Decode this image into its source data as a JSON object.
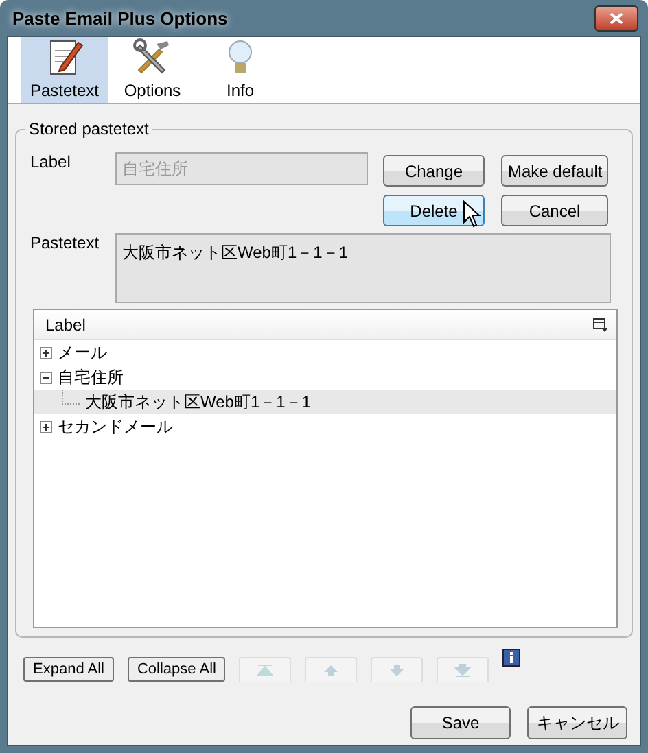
{
  "window": {
    "title": "Paste Email Plus Options"
  },
  "tabs": [
    {
      "label": "Pastetext",
      "selected": true
    },
    {
      "label": "Options",
      "selected": false
    },
    {
      "label": "Info",
      "selected": false
    }
  ],
  "group": {
    "title": "Stored pastetext",
    "label_field": {
      "label": "Label",
      "value": "自宅住所",
      "disabled": true
    },
    "buttons": [
      {
        "label": "Change",
        "hovered": false
      },
      {
        "label": "Make default",
        "hovered": false
      },
      {
        "label": "Delete",
        "hovered": true
      },
      {
        "label": "Cancel",
        "hovered": false
      }
    ],
    "pastetext_field": {
      "label": "Pastetext",
      "value": "大阪市ネット区Web町1－1－1"
    },
    "tree": {
      "column": "Label",
      "items": [
        {
          "label": "メール",
          "expanded": false,
          "selected": false
        },
        {
          "label": "自宅住所",
          "expanded": true,
          "selected": false,
          "children": [
            {
              "label": "大阪市ネット区Web町1－1－1",
              "selected": true
            }
          ]
        },
        {
          "label": "セカンドメール",
          "expanded": false,
          "selected": false
        }
      ]
    }
  },
  "bottom_buttons": [
    {
      "label": "Expand All"
    },
    {
      "label": "Collapse All"
    }
  ],
  "move_buttons": [
    {
      "kind": "top",
      "disabled": true
    },
    {
      "kind": "up",
      "disabled": true
    },
    {
      "kind": "down",
      "disabled": true
    },
    {
      "kind": "bottom",
      "disabled": true
    }
  ],
  "dialog_buttons": [
    {
      "label": "Save"
    },
    {
      "label": "キャンセル"
    }
  ]
}
